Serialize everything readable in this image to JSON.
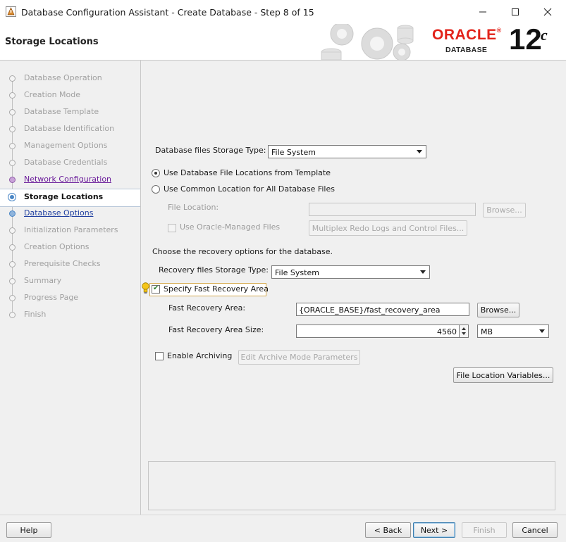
{
  "window": {
    "title": "Database Configuration Assistant - Create Database - Step 8 of 15",
    "controls": {
      "minimize": "–",
      "maximize": "☐",
      "close": "✕"
    }
  },
  "header": {
    "page_title": "Storage Locations",
    "brand": {
      "wordmark": "ORACLE",
      "registered": "®",
      "product": "DATABASE",
      "version": "12",
      "version_suffix": "c"
    }
  },
  "nav": {
    "items": [
      {
        "label": "Database Operation",
        "state": "done"
      },
      {
        "label": "Creation Mode",
        "state": "done"
      },
      {
        "label": "Database Template",
        "state": "done"
      },
      {
        "label": "Database Identification",
        "state": "done"
      },
      {
        "label": "Management Options",
        "state": "done"
      },
      {
        "label": "Database Credentials",
        "state": "done"
      },
      {
        "label": "Network Configuration",
        "state": "visited"
      },
      {
        "label": "Storage Locations",
        "state": "current"
      },
      {
        "label": "Database Options",
        "state": "link"
      },
      {
        "label": "Initialization Parameters",
        "state": "disabled"
      },
      {
        "label": "Creation Options",
        "state": "disabled"
      },
      {
        "label": "Prerequisite Checks",
        "state": "disabled"
      },
      {
        "label": "Summary",
        "state": "disabled"
      },
      {
        "label": "Progress Page",
        "state": "disabled"
      },
      {
        "label": "Finish",
        "state": "disabled"
      }
    ]
  },
  "storage": {
    "type_label": "Database files Storage Type:",
    "type_value": "File System",
    "option_template": "Use Database File Locations from Template",
    "option_common": "Use Common Location for All Database Files",
    "file_location_label": "File Location:",
    "file_location_value": "",
    "browse_label": "Browse...",
    "omf_label": "Use Oracle-Managed Files",
    "multiplex_label": "Multiplex Redo Logs and Control Files..."
  },
  "recovery": {
    "intro": "Choose the recovery options for the database.",
    "type_label": "Recovery files Storage Type:",
    "type_value": "File System",
    "fra_check_label": "Specify Fast Recovery Area",
    "fra_label": "Fast Recovery Area:",
    "fra_value": "{ORACLE_BASE}/fast_recovery_area",
    "browse_label": "Browse...",
    "size_label": "Fast Recovery Area Size:",
    "size_value": "4560",
    "size_unit": "MB",
    "archiving_label": "Enable Archiving",
    "archive_params_label": "Edit Archive Mode Parameters",
    "variables_label": "File Location Variables..."
  },
  "footer": {
    "help": "Help",
    "back": "< Back",
    "next": "Next >",
    "finish": "Finish",
    "cancel": "Cancel"
  },
  "colors": {
    "oracle_red": "#e2231a",
    "link_blue": "#1f3fa0",
    "visited_purple": "#6a1b9a"
  }
}
